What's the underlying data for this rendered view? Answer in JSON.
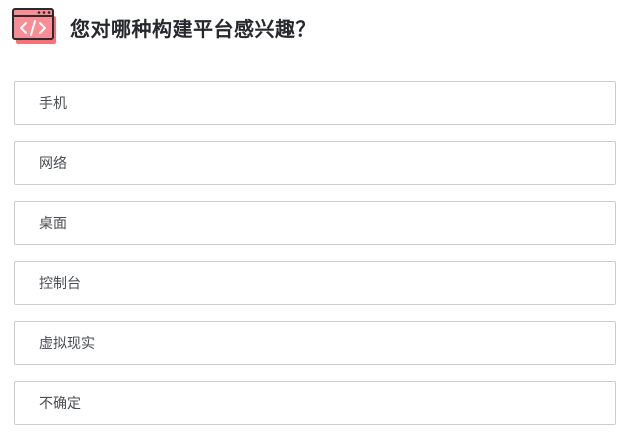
{
  "question": {
    "icon": "code-window-icon",
    "title": "您对哪种构建平台感兴趣？"
  },
  "options": [
    {
      "label": "手机"
    },
    {
      "label": "网络"
    },
    {
      "label": "桌面"
    },
    {
      "label": "控制台"
    },
    {
      "label": "虚拟现实"
    },
    {
      "label": "不确定"
    }
  ],
  "colors": {
    "icon_fill": "#f7707a",
    "icon_outline": "#2b2b2b",
    "title_text": "#26282d",
    "option_border": "#c9ccd1",
    "option_text": "#4a4d52"
  }
}
